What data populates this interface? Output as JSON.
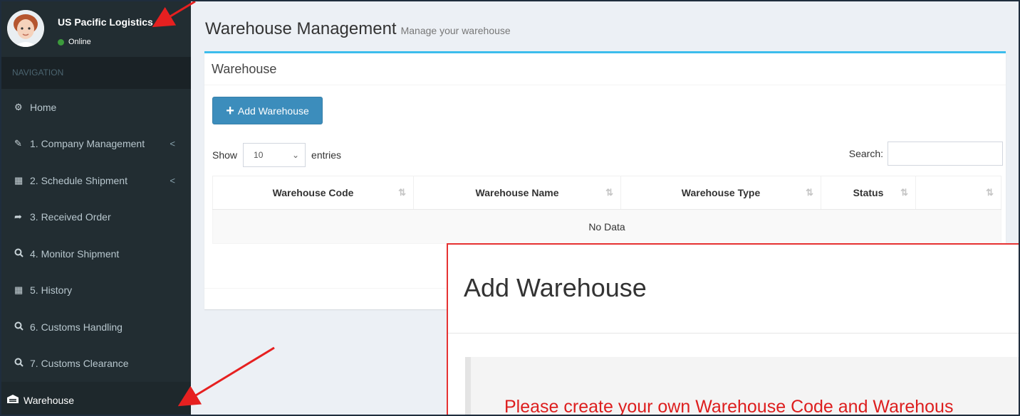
{
  "user": {
    "name": "US Pacific Logistics",
    "status": "Online"
  },
  "nav": {
    "header": "NAVIGATION",
    "items": [
      {
        "label": "Home",
        "icon": "dashboard-icon",
        "submenu": false
      },
      {
        "label": "1. Company Management",
        "icon": "edit-icon",
        "submenu": true
      },
      {
        "label": "2. Schedule Shipment",
        "icon": "calendar-icon",
        "submenu": true
      },
      {
        "label": "3. Received Order",
        "icon": "share-icon",
        "submenu": false
      },
      {
        "label": "4. Monitor Shipment",
        "icon": "search-icon",
        "submenu": false
      },
      {
        "label": "5. History",
        "icon": "calendar-icon",
        "submenu": false
      },
      {
        "label": "6. Customs Handling",
        "icon": "search-icon",
        "submenu": false
      },
      {
        "label": "7. Customs Clearance",
        "icon": "search-icon",
        "submenu": false
      },
      {
        "label": "Warehouse",
        "icon": "warehouse-icon",
        "submenu": false,
        "active": true
      }
    ]
  },
  "page": {
    "title": "Warehouse Management",
    "subtitle": "Manage your warehouse"
  },
  "box": {
    "title": "Warehouse",
    "add_button": "Add Warehouse"
  },
  "table_controls": {
    "show_label": "Show",
    "entries_value": "10",
    "entries_label": "entries",
    "search_label": "Search:"
  },
  "table": {
    "columns": [
      "Warehouse Code",
      "Warehouse Name",
      "Warehouse Type",
      "Status",
      ""
    ],
    "empty_text": "No Data"
  },
  "modal": {
    "title": "Add Warehouse",
    "note": "Please create your own Warehouse Code and Warehous"
  },
  "colors": {
    "accent": "#3c8dbc",
    "box_top": "#3cbdec",
    "sidebar": "#222d32",
    "annotation": "#e63232"
  }
}
